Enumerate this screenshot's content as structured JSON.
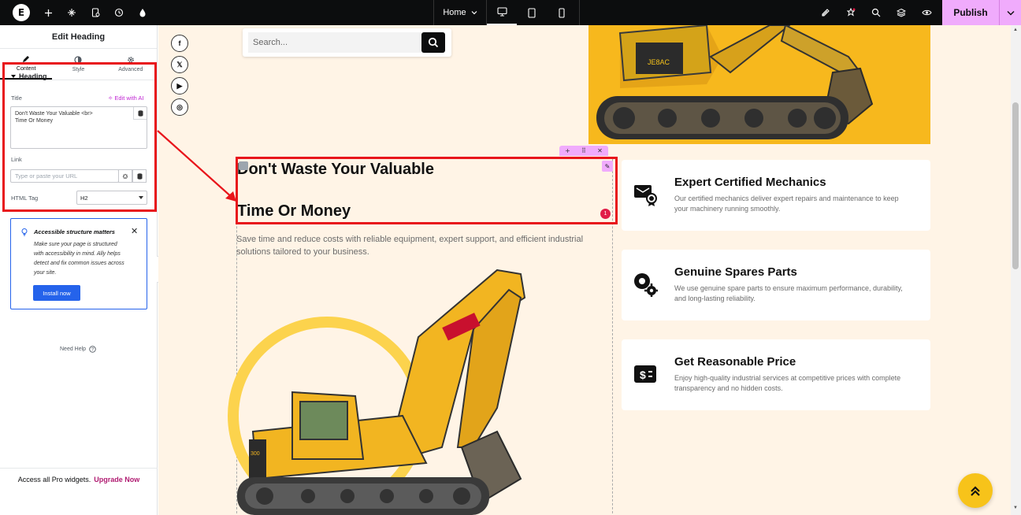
{
  "topbar": {
    "logo": "E",
    "page_name": "Home",
    "publish_label": "Publish",
    "icons_left": [
      "add-icon",
      "structure-icon",
      "page-settings-icon",
      "history-icon",
      "site-settings-icon"
    ],
    "devices": [
      "desktop-icon",
      "tablet-icon",
      "mobile-icon"
    ],
    "icons_right": [
      "ai-icon",
      "notes-icon",
      "search-icon",
      "layers-icon",
      "preview-icon"
    ]
  },
  "panel": {
    "title": "Edit Heading",
    "tabs": [
      {
        "label": "Content",
        "icon": "pencil-icon"
      },
      {
        "label": "Style",
        "icon": "contrast-icon"
      },
      {
        "label": "Advanced",
        "icon": "gear-icon"
      }
    ],
    "section_title": "Heading",
    "title_label": "Title",
    "edit_ai_label": "Edit with AI",
    "title_value_line1": "Don't Waste Your Valuable <br>",
    "title_value_line2": "Time Or Money",
    "link_label": "Link",
    "link_placeholder": "Type or paste your URL",
    "html_tag_label": "HTML Tag",
    "html_tag_value": "H2",
    "notice": {
      "title": "Accessible structure matters",
      "body": "Make sure your page is structured with accessibility in mind. Ally helps detect and fix common issues across your site.",
      "button": "Install now"
    },
    "need_help": "Need Help",
    "footer_text": "Access all Pro widgets.",
    "footer_link": "Upgrade Now"
  },
  "canvas": {
    "social": [
      "f",
      "𝕏",
      "▶",
      "◎"
    ],
    "search_placeholder": "Search...",
    "heading_line1": "Don't Waste Your Valuable",
    "heading_line2": "Time Or Money",
    "badge_count": "1",
    "subtext": "Save time and reduce costs with reliable equipment, expert support, and efficient industrial solutions tailored to your business.",
    "cards": [
      {
        "title": "Expert Certified Mechanics",
        "desc": "Our certified mechanics deliver expert repairs and maintenance to keep your machinery running smoothly.",
        "icon": "certificate-icon"
      },
      {
        "title": "Genuine Spares Parts",
        "desc": "We use genuine spare parts to ensure maximum performance, durability, and long-lasting reliability.",
        "icon": "gears-icon"
      },
      {
        "title": "Get Reasonable Price",
        "desc": "Enjoy high-quality industrial services at competitive prices with complete transparency and no hidden costs.",
        "icon": "price-tag-icon"
      }
    ]
  },
  "colors": {
    "accent_pink": "#f0abfc",
    "highlight_red": "#e8151b",
    "canvas_bg": "#fff4e6",
    "brand_yellow": "#f7c31a",
    "notice_blue": "#2563eb"
  }
}
